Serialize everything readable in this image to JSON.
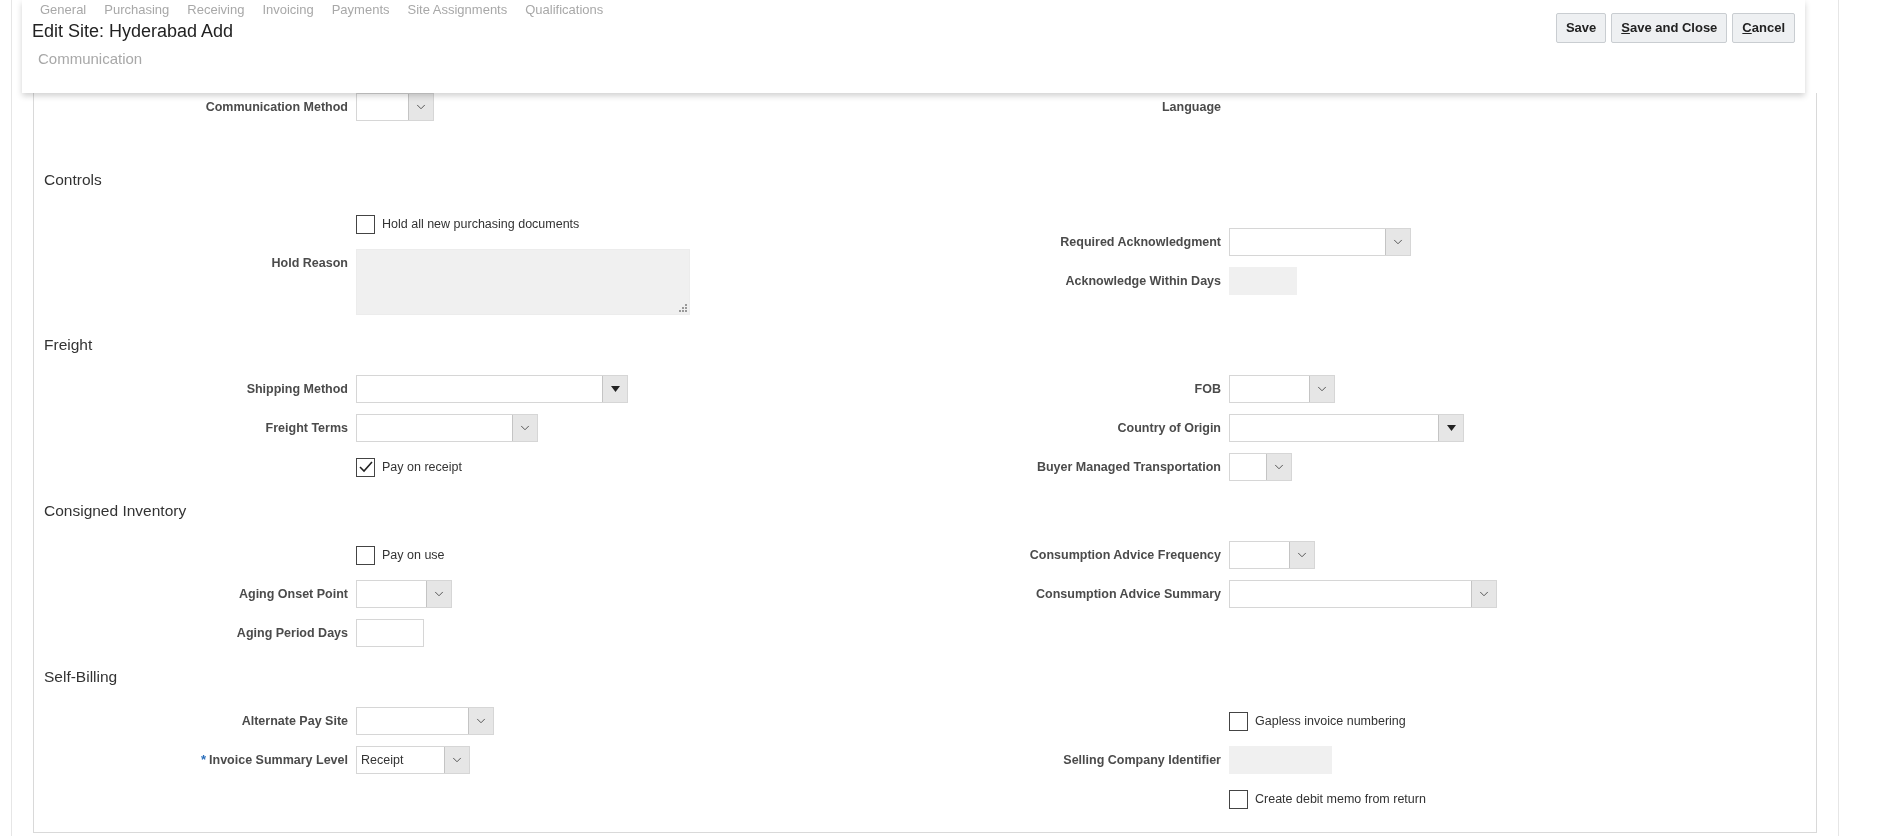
{
  "background_tabs": [
    "General",
    "Purchasing",
    "Receiving",
    "Invoicing",
    "Payments",
    "Site Assignments",
    "Qualifications"
  ],
  "title": "Edit Site: Hyderabad Add",
  "buttons": [
    {
      "label": "Save",
      "mnemonic": false
    },
    {
      "label": "Save and Close",
      "mnemonic": true
    },
    {
      "label": "Cancel",
      "mnemonic": true
    }
  ],
  "sections": [
    {
      "title": "Communication",
      "faded": true,
      "left": [
        {
          "kind": "select",
          "label": "Communication Method"
        }
      ],
      "right": [
        {
          "kind": "output",
          "label": "Language"
        }
      ]
    },
    {
      "title": "Controls",
      "faded": false,
      "left": [
        {
          "kind": "checkbox",
          "text": "Hold all new purchasing documents",
          "checked": false
        },
        {
          "kind": "textarea",
          "label": "Hold Reason",
          "disabled": true
        }
      ],
      "right": [
        {
          "kind": "select",
          "label": "Required Acknowledgment"
        },
        {
          "kind": "text",
          "label": "Acknowledge Within Days",
          "disabled": true
        }
      ]
    },
    {
      "title": "Freight",
      "faded": false,
      "left": [
        {
          "kind": "combo",
          "label": "Shipping Method"
        },
        {
          "kind": "select",
          "label": "Freight Terms"
        },
        {
          "kind": "checkbox",
          "text": "Pay on receipt",
          "checked": true
        }
      ],
      "right": [
        {
          "kind": "select",
          "label": "FOB"
        },
        {
          "kind": "combo",
          "label": "Country of Origin"
        },
        {
          "kind": "select",
          "label": "Buyer Managed Transportation"
        }
      ]
    },
    {
      "title": "Consigned Inventory",
      "faded": false,
      "left": [
        {
          "kind": "checkbox",
          "text": "Pay on use",
          "checked": false
        },
        {
          "kind": "select",
          "label": "Aging Onset Point"
        },
        {
          "kind": "text",
          "label": "Aging Period Days",
          "disabled": false
        }
      ],
      "right": [
        {
          "kind": "select",
          "label": "Consumption Advice Frequency"
        },
        {
          "kind": "select",
          "label": "Consumption Advice Summary"
        }
      ]
    },
    {
      "title": "Self-Billing",
      "faded": false,
      "left": [
        {
          "kind": "select",
          "label": "Alternate Pay Site"
        },
        {
          "kind": "select",
          "label": "Invoice Summary Level",
          "required_mark": "*",
          "value": "Receipt"
        }
      ],
      "right": [
        {
          "kind": "checkbox",
          "text": "Gapless invoice numbering",
          "checked": false
        },
        {
          "kind": "text",
          "label": "Selling Company Identifier",
          "disabled": true
        },
        {
          "kind": "checkbox",
          "text": "Create debit memo from return",
          "checked": false
        }
      ]
    }
  ]
}
